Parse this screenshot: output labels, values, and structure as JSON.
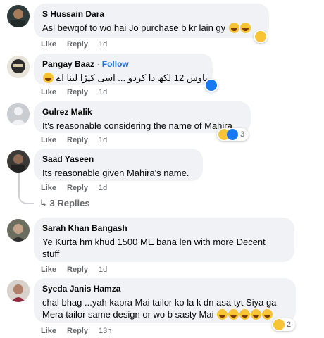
{
  "actions": {
    "like": "Like",
    "reply": "Reply"
  },
  "comments": [
    {
      "name": "S Hussain Dara",
      "text": "Asl bewqof to wo hai Jo purchase b kr lain gy",
      "time": "1d",
      "reaction": "haha"
    },
    {
      "name": "Pangay Baaz",
      "follow": "Follow",
      "separator": "·",
      "text": "باوس 12 لکھ دا کردو ... اسی کپڑا لینا اے",
      "time": "1d",
      "reaction": "like"
    },
    {
      "name": "Gulrez Malik",
      "text": "It's reasonable considering the name of Mahira",
      "time": "1d",
      "reaction_count": "3"
    },
    {
      "name": "Saad Yaseen",
      "text": "Its reasonable given Mahira's name.",
      "time": "1d"
    },
    {
      "name": "Sarah Khan Bangash",
      "text_line1": "Ye Kurta hm khud 1500 ME bana len with more Decent",
      "text_line2": "stuff",
      "time": "1d"
    },
    {
      "name": "Syeda Janis Hamza",
      "text_line1": "chal bhag ...yah kapra Mai tailor ko la k dn asa tyt Siya ga",
      "text_line2": "Mera tailor same design or wo b sasty Mai",
      "time": "13h",
      "reaction_count": "2"
    }
  ],
  "replies_link": "3 Replies",
  "colors": {
    "bubble": "#f0f2f5",
    "meta": "#65676b",
    "follow": "#216fdb",
    "haha": "#f7c436",
    "like": "#1877f2"
  }
}
